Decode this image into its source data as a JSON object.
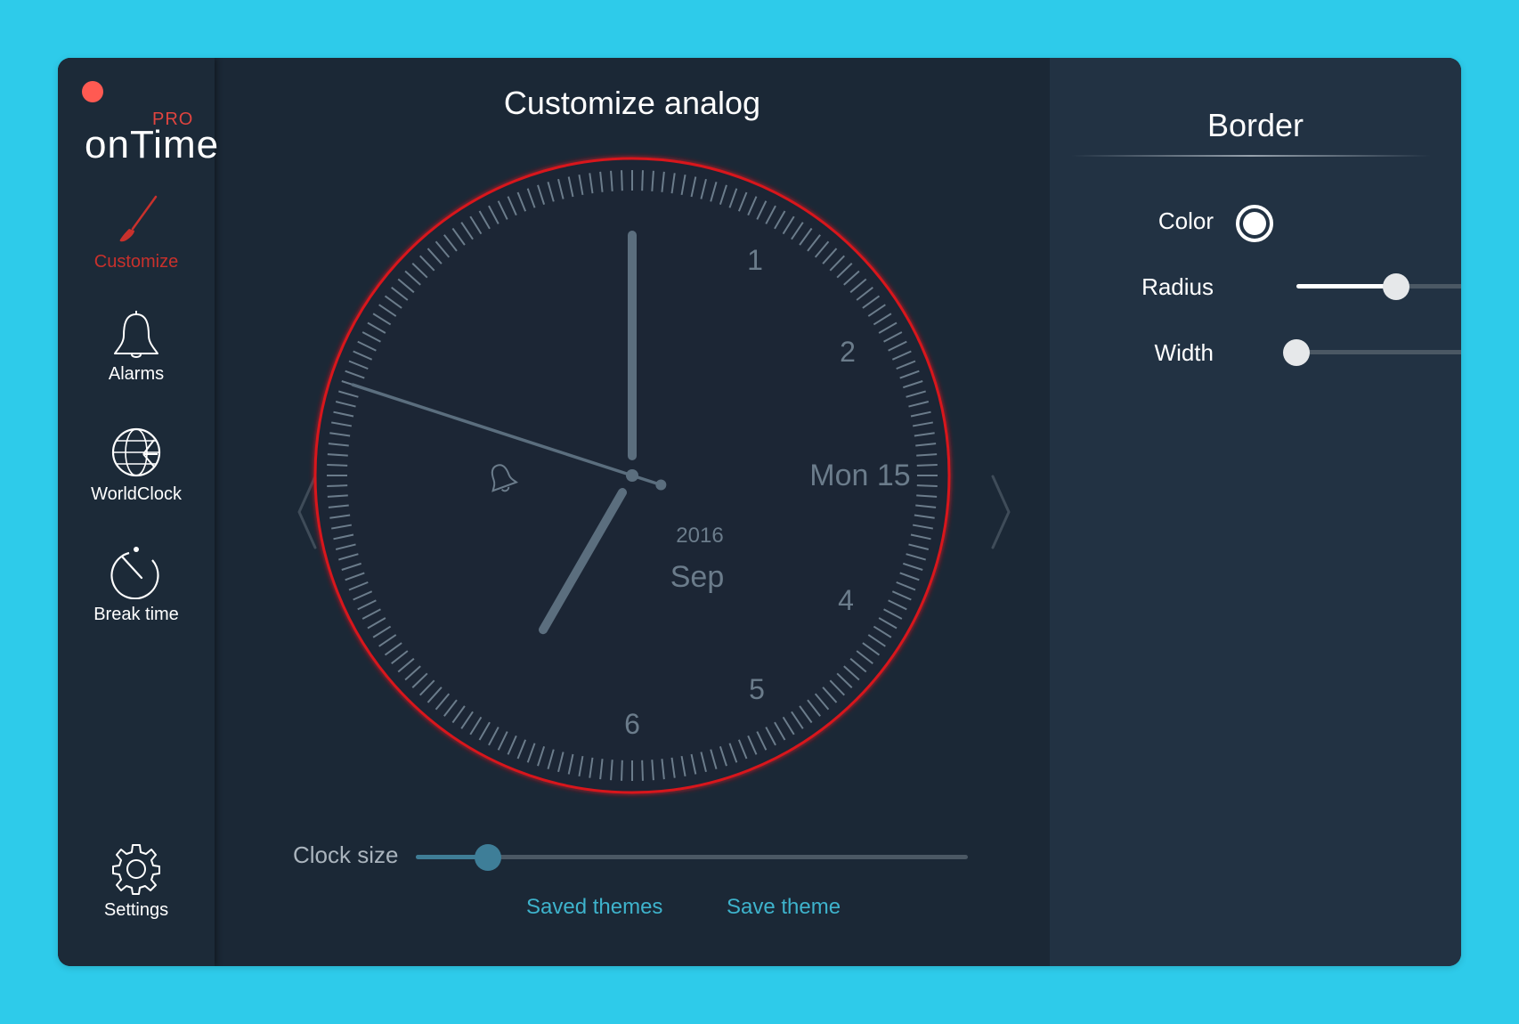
{
  "window": {
    "close_color": "#ff5a52"
  },
  "logo": {
    "brand": "onTime",
    "badge": "PRO"
  },
  "sidebar": {
    "items": [
      {
        "label": "Customize",
        "icon": "brush-icon",
        "active": true
      },
      {
        "label": "Alarms",
        "icon": "bell-icon",
        "active": false
      },
      {
        "label": "WorldClock",
        "icon": "globe-icon",
        "active": false
      },
      {
        "label": "Break time",
        "icon": "stopwatch-icon",
        "active": false
      },
      {
        "label": "Settings",
        "icon": "gear-icon",
        "active": false
      }
    ]
  },
  "main": {
    "title": "Customize analog",
    "clock": {
      "numerals": [
        "1",
        "2",
        "4",
        "5",
        "6"
      ],
      "date_label": "Mon 15",
      "year_label": "2016",
      "month_label": "Sep",
      "time": {
        "hour": 7,
        "minute": 0,
        "second": 48
      },
      "border_color": "#d8161a",
      "alarm_icon": "bell-icon"
    },
    "clock_size": {
      "label": "Clock size",
      "value": 0.13
    },
    "links": {
      "saved_themes": "Saved themes",
      "save_theme": "Save theme"
    }
  },
  "panel": {
    "title": "Border",
    "color": {
      "label": "Color",
      "value": "#ffffff"
    },
    "radius": {
      "label": "Radius",
      "value": 0.55
    },
    "width": {
      "label": "Width",
      "value": 0.0
    }
  },
  "colors": {
    "accent": "#c8312c",
    "link": "#3eb3cc",
    "background": "#2ecbea",
    "hand": "#5b6e7e"
  }
}
